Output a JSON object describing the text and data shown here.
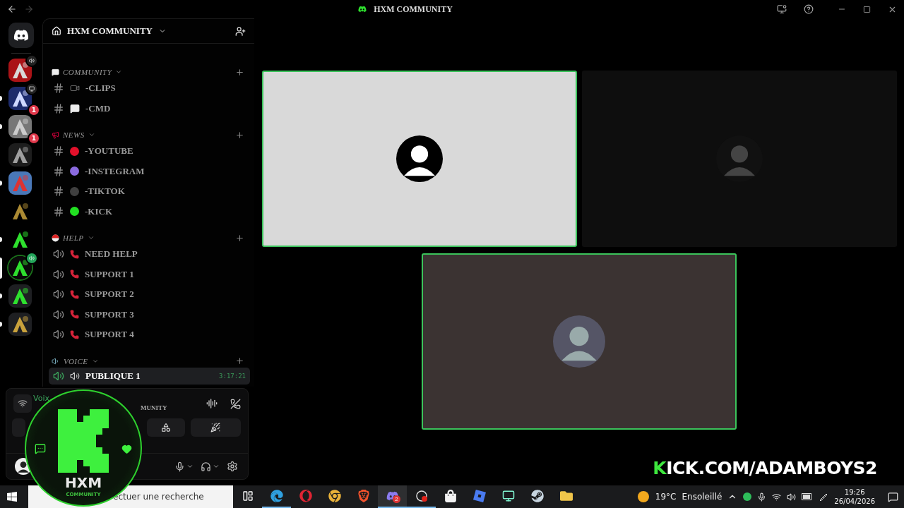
{
  "window": {
    "title": "HXM COMMUNITY"
  },
  "servers": [
    {
      "kind": "red",
      "voice": true,
      "screen": false,
      "unread": false,
      "selected": false
    },
    {
      "kind": "blue",
      "badge": "1",
      "voice": false,
      "screen": true,
      "unread": true,
      "selected": false
    },
    {
      "kind": "grey",
      "badge": "1",
      "voice": false,
      "screen": false,
      "unread": true,
      "selected": false
    },
    {
      "kind": "dark",
      "voice": false,
      "screen": false,
      "unread": false,
      "selected": false
    },
    {
      "kind": "sky",
      "voice": false,
      "screen": false,
      "unread": true,
      "selected": false
    },
    {
      "kind": "gold",
      "voice": false,
      "screen": false,
      "unread": false,
      "selected": false
    },
    {
      "kind": "green",
      "voice": false,
      "screen": false,
      "unread": true,
      "selected": false
    },
    {
      "kind": "hxm",
      "voice": true,
      "screen": false,
      "unread": false,
      "selected": true
    },
    {
      "kind": "folder",
      "voice": false,
      "screen": false,
      "unread": true,
      "selected": false
    },
    {
      "kind": "folder2",
      "voice": false,
      "screen": false,
      "unread": true,
      "selected": false
    }
  ],
  "server": {
    "name": "HXM COMMUNITY"
  },
  "categories": [
    {
      "name": "COMMUNITY",
      "kind": "chat",
      "channels": [
        {
          "kind": "text-camera",
          "name": "-CLIPS"
        },
        {
          "kind": "text-chat",
          "name": "-CMD"
        }
      ]
    },
    {
      "name": "NEWS",
      "kind": "megaphone",
      "channels": [
        {
          "kind": "text-dot",
          "color": "#e3112b",
          "name": "-YOUTUBE"
        },
        {
          "kind": "text-dot",
          "color": "#8b6be0",
          "name": "-INSTEGRAM"
        },
        {
          "kind": "text-dot",
          "color": "#404040",
          "name": "-TIKTOK"
        },
        {
          "kind": "text-dot",
          "color": "#22e022",
          "name": "-KICK"
        }
      ]
    },
    {
      "name": "HELP",
      "kind": "ball",
      "channels": [
        {
          "kind": "voice-phone",
          "name": "NEED HELP"
        },
        {
          "kind": "voice-phone",
          "name": "SUPPORT 1"
        },
        {
          "kind": "voice-phone",
          "name": "SUPPORT 2"
        },
        {
          "kind": "voice-phone",
          "name": "SUPPORT 3"
        },
        {
          "kind": "voice-phone",
          "name": "SUPPORT 4"
        }
      ]
    },
    {
      "name": "VOICE",
      "kind": "speaker",
      "channels": [
        {
          "kind": "voice-speaker",
          "name": "PUBLIQUE 1",
          "timer": "3:17:21",
          "selected": true
        }
      ]
    }
  ],
  "voice_panel": {
    "status": "Voix",
    "channel": "MUNITY"
  },
  "tiles": [
    {
      "color": "#d9d9d9",
      "speaking": true
    },
    {
      "color": "#0e0e0e",
      "speaking": false
    },
    {
      "color": "#3b3332",
      "speaking": true
    }
  ],
  "overlay": {
    "logo_title": "HXM",
    "logo_subtitle": "COMMUNITY",
    "stream_link": "KICK.COM/ADAMBOYS2"
  },
  "taskbar": {
    "search": {
      "placeholder": "ectuer une recherche"
    },
    "apps": [
      {
        "kind": "edge",
        "running": true
      },
      {
        "kind": "opera",
        "running": false
      },
      {
        "kind": "chrome",
        "running": false
      },
      {
        "kind": "brave",
        "running": false
      },
      {
        "kind": "discord",
        "running": true,
        "badge": "2"
      },
      {
        "kind": "rec",
        "running": true
      },
      {
        "kind": "store",
        "running": false
      },
      {
        "kind": "roblox",
        "running": false
      },
      {
        "kind": "streamlabs",
        "running": false
      },
      {
        "kind": "steam",
        "running": false
      },
      {
        "kind": "folder",
        "running": false
      }
    ],
    "weather": {
      "temp": "19°C",
      "condition": "Ensoleillé"
    },
    "time": "19:26",
    "date": "26/04/2026"
  }
}
